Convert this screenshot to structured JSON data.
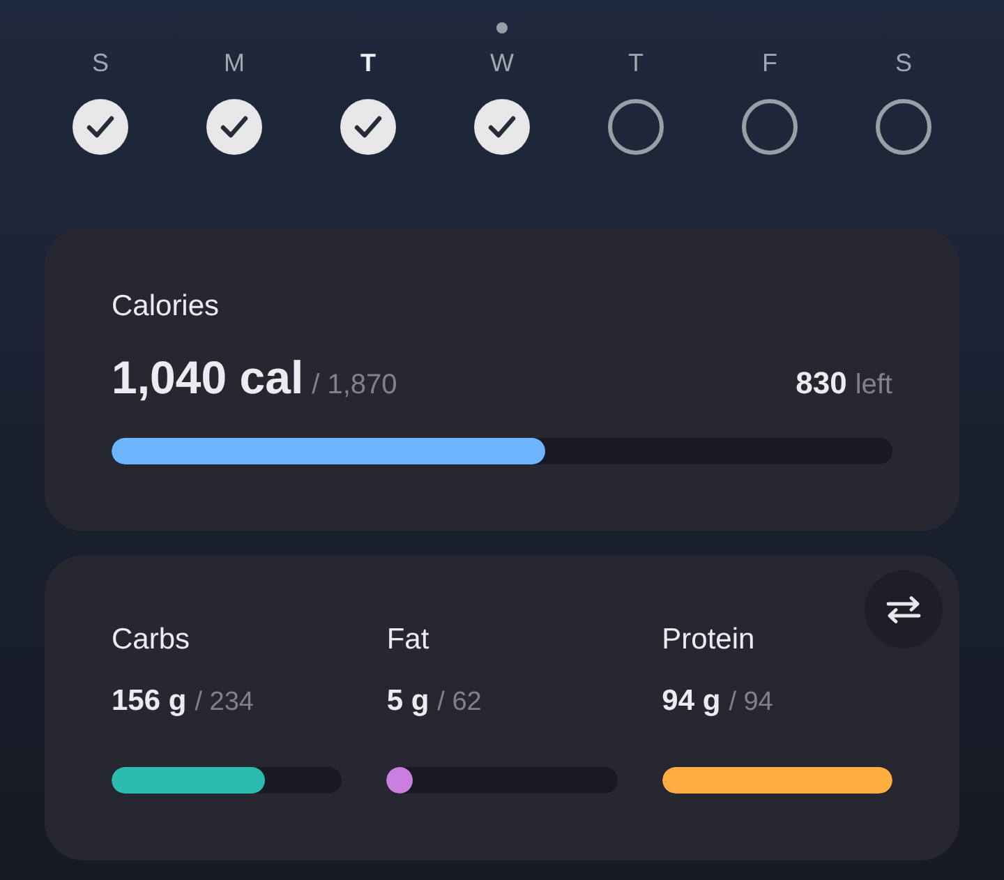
{
  "week": {
    "days": [
      {
        "letter": "S",
        "checked": true,
        "selected": false,
        "today": false
      },
      {
        "letter": "M",
        "checked": true,
        "selected": false,
        "today": false
      },
      {
        "letter": "T",
        "checked": true,
        "selected": true,
        "today": false
      },
      {
        "letter": "W",
        "checked": true,
        "selected": false,
        "today": true
      },
      {
        "letter": "T",
        "checked": false,
        "selected": false,
        "today": false
      },
      {
        "letter": "F",
        "checked": false,
        "selected": false,
        "today": false
      },
      {
        "letter": "S",
        "checked": false,
        "selected": false,
        "today": false
      }
    ]
  },
  "calories": {
    "title": "Calories",
    "consumed": "1,040 cal",
    "goal": "/ 1,870",
    "remaining": "830",
    "remaining_label": "left",
    "level": 0.556
  },
  "macros": {
    "items": [
      {
        "name": "Carbs",
        "amount": "156 g",
        "goal": "/ 234",
        "level": 0.667,
        "color": "#2dbbb0"
      },
      {
        "name": "Fat",
        "amount": "5 g",
        "goal": "/ 62",
        "level": 0.08,
        "color": "#c87fe0"
      },
      {
        "name": "Protein",
        "amount": "94 g",
        "goal": "/ 94",
        "level": 1,
        "color": "#ffad40"
      }
    ]
  }
}
